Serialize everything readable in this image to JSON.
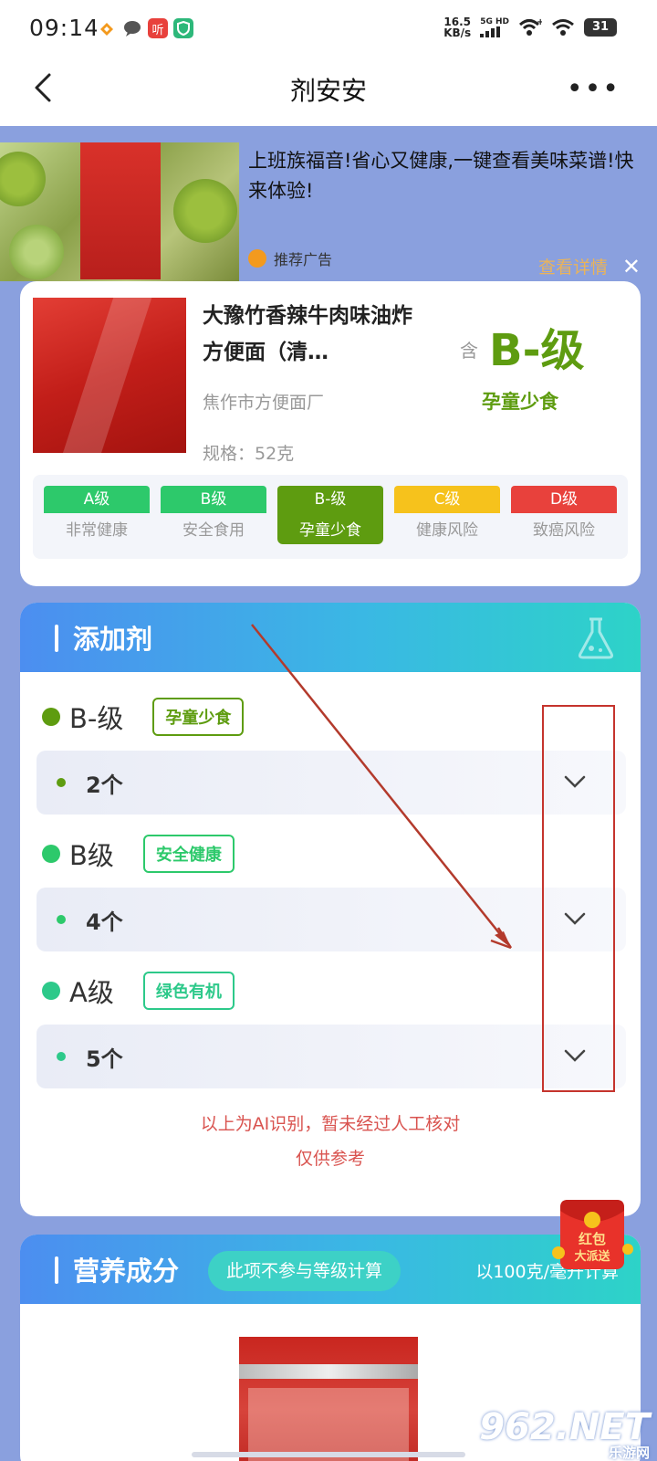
{
  "status": {
    "time": "09:14",
    "speed_value": "16.5",
    "speed_unit": "KB/s",
    "network": "5G HD",
    "battery": "31",
    "app_icons": [
      "huawei-health-icon",
      "message-icon",
      "ting-icon",
      "shield-app-icon"
    ]
  },
  "nav": {
    "title": "剂安安",
    "more": "•••"
  },
  "ad": {
    "text": "上班族福音!省心又健康,一键查看美味菜谱!快来体验!",
    "tag": "推荐广告",
    "detail": "查看详情",
    "close": "✕"
  },
  "product": {
    "name": "大豫竹香辣牛肉味油炸方便面（清…",
    "maker": "焦作市方便面厂",
    "spec": "规格：52克",
    "contains_label": "含",
    "grade": "B-级",
    "grade_desc": "孕童少食",
    "scale": [
      {
        "label": "A级",
        "desc": "非常健康",
        "color": "#2dc96b",
        "active": false
      },
      {
        "label": "B级",
        "desc": "安全食用",
        "color": "#2dc96b",
        "active": false
      },
      {
        "label": "B-级",
        "desc": "孕童少食",
        "color": "#5e9c10",
        "active": true
      },
      {
        "label": "C级",
        "desc": "健康风险",
        "color": "#f6c21c",
        "active": false
      },
      {
        "label": "D级",
        "desc": "致癌风险",
        "color": "#e8413c",
        "active": false
      }
    ]
  },
  "additives": {
    "title": "添加剂",
    "groups": [
      {
        "grade": "B-级",
        "tag": "孕童少食",
        "count": "2个",
        "color": "#5e9c10"
      },
      {
        "grade": "B级",
        "tag": "安全健康",
        "count": "4个",
        "color": "#2dc96b"
      },
      {
        "grade": "A级",
        "tag": "绿色有机",
        "count": "5个",
        "color": "#2dc98a"
      }
    ],
    "note_line1": "以上为AI识别，暂未经过人工核对",
    "note_line2": "仅供参考"
  },
  "nutrition": {
    "title": "营养成分",
    "pill": "此项不参与等级计算",
    "per": "以100克/毫升计算"
  },
  "redpacket": {
    "text_top": "红包",
    "text_bottom": "大派送"
  },
  "watermark": {
    "main": "962.NET",
    "sub": "乐游网"
  }
}
